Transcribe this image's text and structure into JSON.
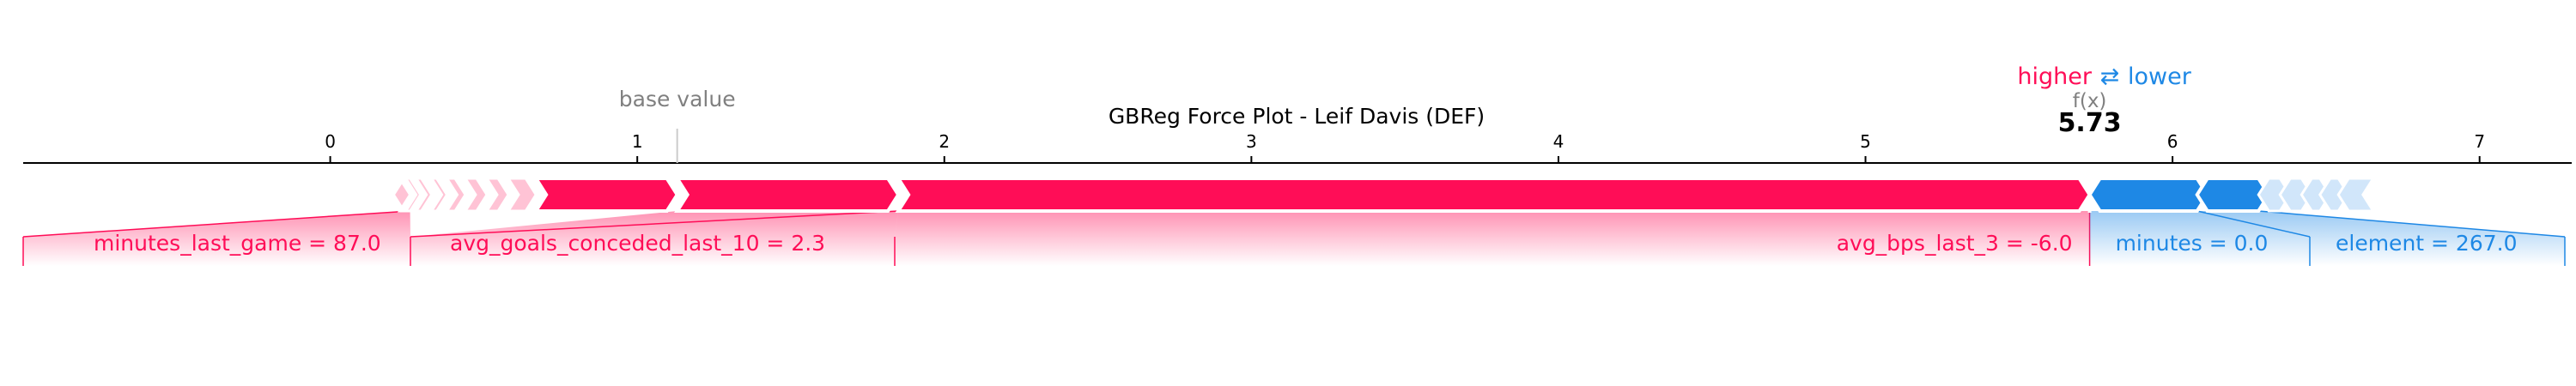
{
  "colors": {
    "positive": "#ff0d57",
    "negative": "#1e88e5",
    "positive_light": "#ffc3d5",
    "negative_light": "#d1e6fa",
    "axis": "#000000",
    "muted": "#808080"
  },
  "legend": {
    "higher": "higher",
    "arrows": "⇄",
    "lower": "lower"
  },
  "chart_data": {
    "type": "force",
    "title": "GBReg Force Plot - Leif Davis (DEF)",
    "base_value_label": "base value",
    "fx_label": "f(x)",
    "fx_value_text": "5.73",
    "xlim": [
      -1.0,
      7.3
    ],
    "ticks": [
      "0",
      "1",
      "2",
      "3",
      "4",
      "5",
      "6",
      "7"
    ],
    "base_value": 1.13,
    "output_value": 5.73,
    "positive_features": [
      {
        "label": "minutes_last_game = 87.0",
        "start": 0.24,
        "end": 0.26
      },
      {
        "label": "",
        "start": 0.26,
        "end": 0.28
      },
      {
        "label": "",
        "start": 0.28,
        "end": 0.33
      },
      {
        "label": "",
        "start": 0.33,
        "end": 0.38
      },
      {
        "label": "",
        "start": 0.38,
        "end": 0.44
      },
      {
        "label": "",
        "start": 0.44,
        "end": 0.51
      },
      {
        "label": "",
        "start": 0.51,
        "end": 0.58
      },
      {
        "label": "",
        "start": 0.58,
        "end": 0.67
      },
      {
        "label": "",
        "start": 0.67,
        "end": 1.13
      },
      {
        "label": "avg_goals_conceded_last_10 = 2.3",
        "start": 1.13,
        "end": 1.85
      },
      {
        "label": "avg_bps_last_3 = -6.0",
        "start": 1.85,
        "end": 5.73
      }
    ],
    "negative_features": [
      {
        "label": "minutes = 0.0",
        "start": 5.73,
        "end": 6.08
      },
      {
        "label": "element = 267.0",
        "start": 6.08,
        "end": 6.28
      },
      {
        "label": "",
        "start": 6.28,
        "end": 6.35
      },
      {
        "label": "",
        "start": 6.35,
        "end": 6.42
      },
      {
        "label": "",
        "start": 6.42,
        "end": 6.48
      },
      {
        "label": "",
        "start": 6.48,
        "end": 6.54
      },
      {
        "label": "",
        "start": 6.54,
        "end": 6.62
      }
    ]
  }
}
